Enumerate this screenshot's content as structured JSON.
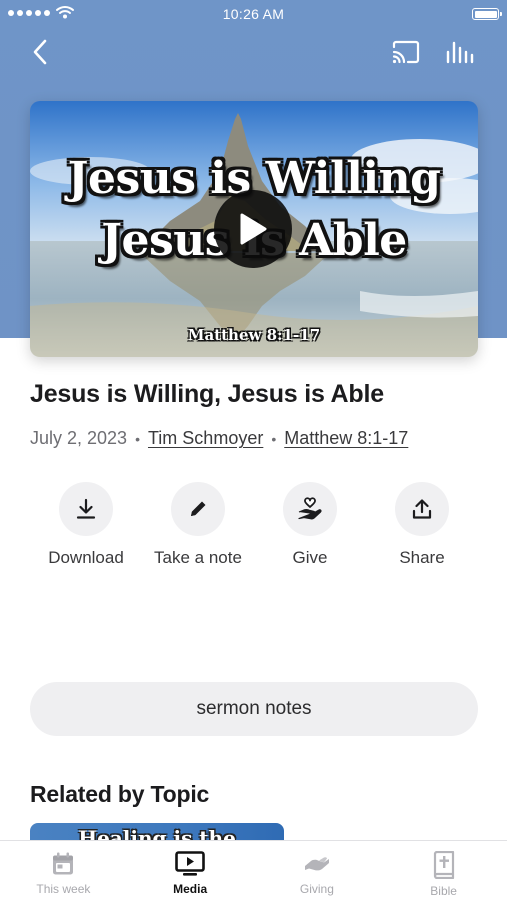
{
  "status_bar": {
    "time": "10:26 AM"
  },
  "header": {
    "back_icon": "chevron-left-icon",
    "cast_icon": "cast-icon",
    "audio_icon": "equalizer-icon"
  },
  "media": {
    "thumbnail_line1": "Jesus is Willing",
    "thumbnail_line2": "Jesus is Able",
    "thumbnail_reference": "Matthew 8:1-17",
    "play_icon": "play-icon"
  },
  "sermon": {
    "title": "Jesus is Willing, Jesus is Able",
    "date": "July 2, 2023",
    "separator": "•",
    "speaker": "Tim Schmoyer",
    "passage": "Matthew 8:1-17"
  },
  "actions": [
    {
      "label": "Download",
      "icon": "download-icon"
    },
    {
      "label": "Take a note",
      "icon": "pencil-icon"
    },
    {
      "label": "Give",
      "icon": "give-hand-heart-icon"
    },
    {
      "label": "Share",
      "icon": "share-icon"
    }
  ],
  "notes_button": {
    "label": "sermon notes"
  },
  "related": {
    "heading": "Related by Topic",
    "card_text": "Healing is the"
  },
  "tabs": [
    {
      "label": "This week",
      "icon": "calendar-icon",
      "active": false
    },
    {
      "label": "Media",
      "icon": "tv-play-icon",
      "active": true
    },
    {
      "label": "Giving",
      "icon": "giving-icon",
      "active": false
    },
    {
      "label": "Bible",
      "icon": "bible-icon",
      "active": false
    }
  ],
  "colors": {
    "header_blue": "#6f95c8",
    "active_tab": "#111111",
    "inactive_tab": "#a8a8ad"
  }
}
